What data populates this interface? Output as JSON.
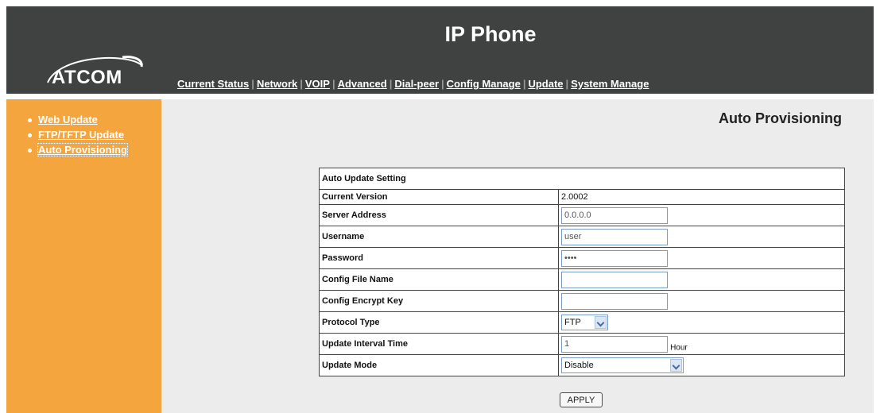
{
  "header": {
    "title": "IP Phone",
    "logo_text": "ATCOM",
    "nav": [
      {
        "label": "Current Status"
      },
      {
        "label": "Network"
      },
      {
        "label": "VOIP"
      },
      {
        "label": "Advanced"
      },
      {
        "label": "Dial-peer"
      },
      {
        "label": "Config Manage"
      },
      {
        "label": "Update"
      },
      {
        "label": "System Manage"
      }
    ]
  },
  "sidebar": {
    "items": [
      {
        "label": "Web Update"
      },
      {
        "label": "FTP/TFTP Update"
      },
      {
        "label": "Auto Provisioning"
      }
    ],
    "active": "Auto Provisioning"
  },
  "main": {
    "page_title": "Auto Provisioning",
    "section_header": "Auto Update Setting",
    "rows": {
      "current_version": {
        "label": "Current Version",
        "value": "2.0002"
      },
      "server_address": {
        "label": "Server Address",
        "value": "0.0.0.0"
      },
      "username": {
        "label": "Username",
        "value": "user"
      },
      "password": {
        "label": "Password",
        "value": "••••"
      },
      "config_file_name": {
        "label": "Config File Name",
        "value": ""
      },
      "config_encrypt_key": {
        "label": "Config Encrypt Key",
        "value": ""
      },
      "protocol_type": {
        "label": "Protocol Type",
        "value": "FTP"
      },
      "update_interval": {
        "label": "Update Interval Time",
        "value": "1",
        "unit": "Hour"
      },
      "update_mode": {
        "label": "Update Mode",
        "value": "Disable"
      }
    },
    "apply_label": "APPLY"
  },
  "colors": {
    "header_bg": "#404242",
    "sidebar_bg": "#f4a53e",
    "content_bg": "#ececec",
    "input_border": "#7a9cc1"
  },
  "icons": {
    "dropdown": "chevron-down-icon",
    "bullet": "bullet-icon"
  }
}
